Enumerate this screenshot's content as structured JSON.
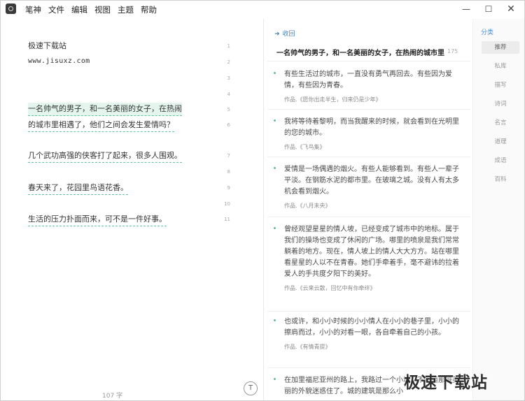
{
  "menu": [
    "笔神",
    "文件",
    "编辑",
    "视图",
    "主题",
    "帮助"
  ],
  "window_controls": {
    "minimize": "—",
    "maximize": "☐",
    "close": "✕"
  },
  "editor": {
    "lines": [
      "极速下载站",
      "www.jisuxz.com",
      "一名帅气的男子，和一名美丽的女子，在热闹",
      "的城市里相遇了，他们之间会发生爱情吗？",
      "几个武功高强的侠客打了起来，很多人围观。",
      "春天来了，花园里鸟语花香。",
      "生活的压力扑面而来，可不是一件好事。"
    ],
    "line_numbers": [
      "1",
      "2",
      "3",
      "4",
      "5",
      "6",
      "7",
      "8",
      "9",
      "10",
      "11"
    ],
    "word_count": "107 字",
    "format_button": "T"
  },
  "panel": {
    "collapse_label": "收回",
    "collapse_icon": "arrow-right-icon",
    "title": "一名帅气的男子，和一名美丽的女子，在热闹的城市里",
    "count": "175",
    "entries": [
      {
        "text": "有些生活过的城市，一直没有勇气再回去。有些因为爱情，有些因为青春。",
        "source": "作品.《愿你出走半生，归来仍是少年》"
      },
      {
        "text": "我将等待着黎明，而当我醒来的时候，就会看到在光明里的您的城市。",
        "source": "作品.《飞鸟集》"
      },
      {
        "text": "爱情是一场偶遇的烟火。有些人能够看到。有些人一辈子平淡。在钢筋水泥的都市里。在玻璃之城。没有人有太多机会看到烟火。",
        "source": "作品.《八月未央》"
      },
      {
        "text": "曾经观望星星的情人坡，已经变成了城市中的地标。属于我们的操场也变成了休闲的广场。哪里的喷泉是我们常常躺着的地方。现在，情人坡上的情人大大方方。站在哪里看星星的人以不在青春。她们手牵着手，毫不避讳的拉着爱人的手共度夕阳下的美好。",
        "source": "作品.《云来云散，回忆中有你牵绊》"
      },
      {
        "text": "也或许，和小小时候的小小情人在小小的巷子里，小小的擦肩而过，小小的对看一眼，各自牵着自己的小孩。",
        "source": "作品.《有情青提》"
      },
      {
        "text": "在加里福尼亚州的路上，我路过一个小城，不知道那城美丽的外貌迷惑住了。城的建筑是那么小",
        "source": ""
      }
    ]
  },
  "categories": {
    "header": "分类",
    "items": [
      "推荐",
      "私库",
      "描写",
      "诗词",
      "名言",
      "道理",
      "成语",
      "百科"
    ],
    "active_index": 0
  },
  "watermark": "极速下载站"
}
